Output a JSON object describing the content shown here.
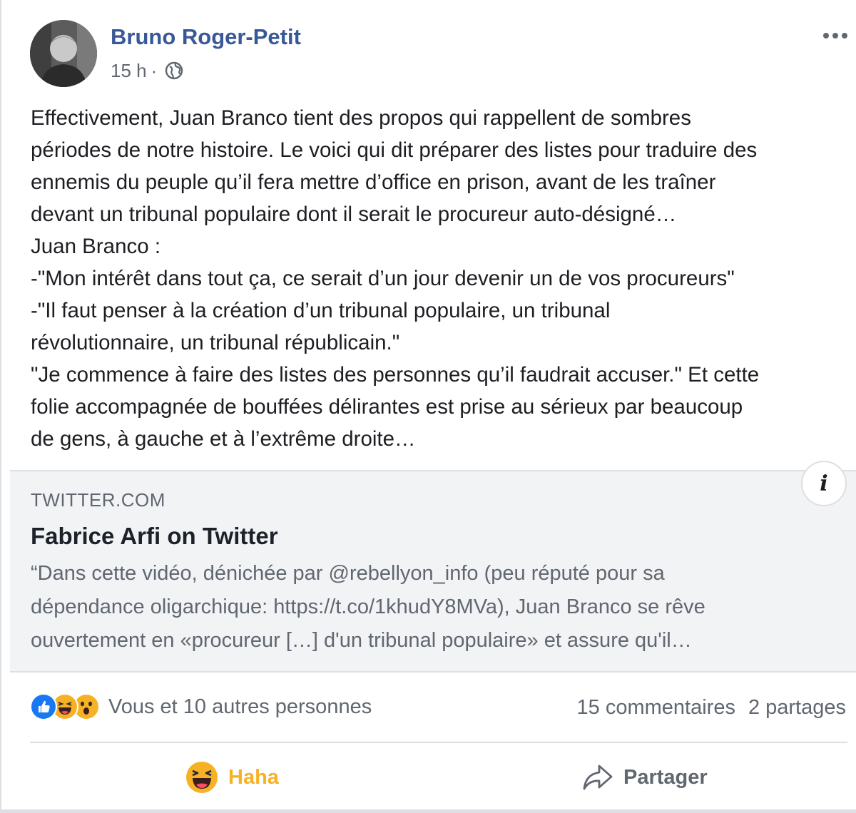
{
  "post": {
    "author": "Bruno Roger-Petit",
    "time": "15 h",
    "separator": "·",
    "privacy_icon": "globe-icon",
    "more_icon": "more-options-icon",
    "text_lines": [
      "Effectivement, Juan Branco tient des propos qui rappellent de sombres",
      "périodes de notre histoire. Le voici qui dit préparer des listes pour traduire des",
      "ennemis du peuple qu’il fera mettre d’office en prison, avant de les traîner",
      "devant un tribunal populaire dont il serait le procureur auto-désigné…",
      "Juan Branco :",
      "-\"Mon intérêt dans tout ça, ce serait d’un jour devenir un de vos procureurs\"",
      "-\"Il faut penser à la création d’un tribunal populaire, un tribunal",
      "révolutionnaire, un tribunal républicain.\"",
      "\"Je commence à faire des listes des personnes qu’il faudrait accuser.\" Et cette",
      "folie accompagnée de bouffées délirantes est prise au sérieux par beaucoup",
      "de gens, à gauche et à l’extrême droite…"
    ]
  },
  "link_preview": {
    "domain": "TWITTER.COM",
    "title": "Fabrice Arfi on Twitter",
    "description_lines": [
      "“Dans cette vidéo, dénichée par @rebellyon_info (peu réputé pour sa",
      "dépendance oligarchique: https://t.co/1khudY8MVa), Juan Branco se rêve",
      "ouvertement en «procureur […] d'un tribunal populaire» et assure qu'il…"
    ],
    "info_label": "i"
  },
  "engagement": {
    "reaction_icons": [
      "like-icon",
      "haha-icon",
      "wow-icon"
    ],
    "reactions_text": "Vous et 10 autres personnes",
    "comments": "15 commentaires",
    "shares": "2 partages"
  },
  "actions": {
    "haha_label": "Haha",
    "share_label": "Partager"
  },
  "colors": {
    "author": "#385898",
    "secondary_text": "#606770",
    "haha": "#f7b125",
    "like": "#1877f2",
    "card_bg": "#f2f3f5"
  }
}
